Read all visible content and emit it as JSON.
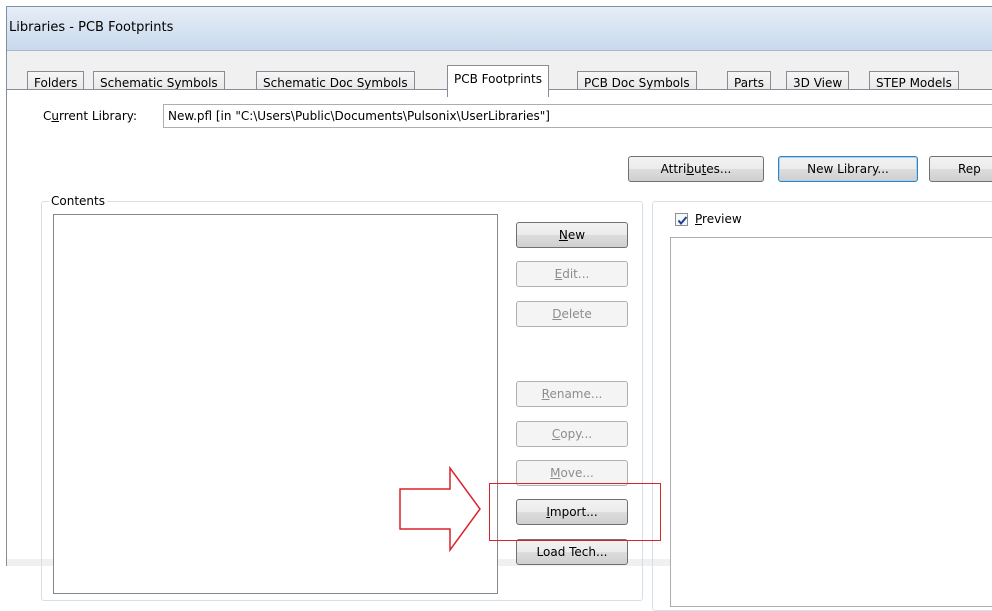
{
  "window": {
    "title": "Libraries - PCB Footprints"
  },
  "tabs": [
    {
      "label": "Folders",
      "active": false
    },
    {
      "label": "Schematic Symbols",
      "active": false
    },
    {
      "label": "Schematic Doc Symbols",
      "active": false
    },
    {
      "label": "PCB Footprints",
      "active": true
    },
    {
      "label": "PCB Doc Symbols",
      "active": false
    },
    {
      "label": "Parts",
      "active": false
    },
    {
      "label": "3D View",
      "active": false
    },
    {
      "label": "STEP Models",
      "active": false
    }
  ],
  "library": {
    "label_pre": "C",
    "label_u": "u",
    "label_post": "rrent Library:",
    "value": "New.pfl   [in \"C:\\Users\\Public\\Documents\\Pulsonix\\UserLibraries\"]"
  },
  "top_buttons": {
    "attributes_pre": "Attri",
    "attributes_u": "b",
    "attributes_mid": "u",
    "attributes_u2": "t",
    "attributes_post": "es...",
    "attributes_full": "Attributes...",
    "new_library": "New Library...",
    "report": "Rep"
  },
  "contents": {
    "legend": "Contents"
  },
  "buttons": {
    "new": {
      "u": "N",
      "rest": "ew"
    },
    "edit": {
      "u": "E",
      "rest": "dit..."
    },
    "delete": {
      "u": "D",
      "rest": "elete"
    },
    "rename": {
      "u": "R",
      "rest": "ename..."
    },
    "copy": {
      "u": "C",
      "rest": "opy..."
    },
    "move": {
      "u": "M",
      "rest": "ove..."
    },
    "import": {
      "u": "I",
      "rest": "mport..."
    },
    "load_tech": "Load Tech..."
  },
  "preview": {
    "u": "P",
    "rest": "review",
    "checked": true
  },
  "colors": {
    "highlight": "#d9242b",
    "title_bar": "#c9d9ec",
    "focus_border": "#3c7fb1"
  },
  "icons": [
    "checkmark-icon",
    "right-arrow-icon"
  ]
}
